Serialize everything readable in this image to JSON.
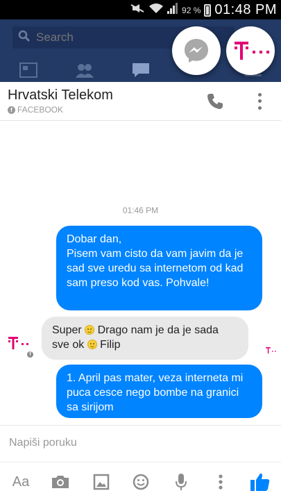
{
  "status_bar": {
    "battery_percent": "92 %",
    "time": "01:48 PM"
  },
  "facebook": {
    "search_placeholder": "Search"
  },
  "chat": {
    "title": "Hrvatski Telekom",
    "source": "FACEBOOK",
    "timestamp": "01:46 PM",
    "messages": [
      {
        "direction": "outgoing",
        "text": "Dobar dan,\nPisem vam cisto da vam javim da je sad sve uredu sa internetom od kad sam preso kod vas. Pohvale!"
      },
      {
        "direction": "incoming",
        "parts": [
          "Super ",
          " Drago nam je da je sada sve ok ",
          " Filip"
        ]
      },
      {
        "direction": "outgoing",
        "text": "1. April pas mater, veza interneta mi puca cesce nego bombe na granici sa sirijom"
      }
    ],
    "composer_placeholder": "Napiši poruku",
    "toolbar": {
      "aa_label": "Aa",
      "icons": [
        "camera-icon",
        "image-icon",
        "emoji-icon",
        "microphone-icon",
        "more-icon",
        "thumbs-up-icon"
      ]
    }
  },
  "colors": {
    "brand_magenta": "#e20074",
    "outgoing_bubble": "#0084ff",
    "incoming_bubble": "#e8e8e8",
    "facebook_blue": "#233a66",
    "like_blue": "#0084ff"
  }
}
